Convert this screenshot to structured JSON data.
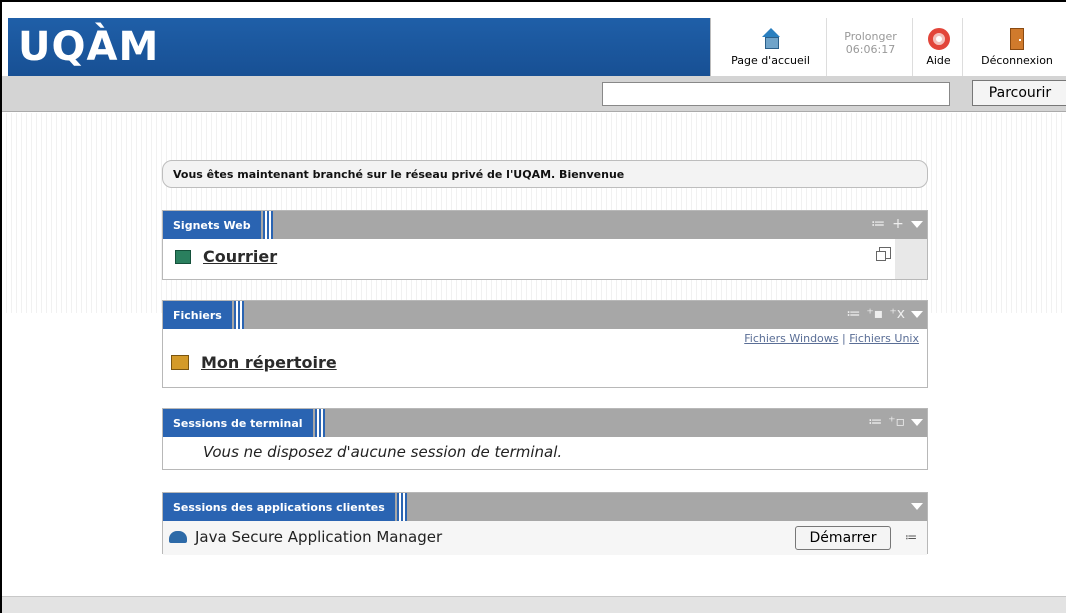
{
  "header": {
    "logo": "UQÀM",
    "home_label": "Page d'accueil",
    "extend_label": "Prolonger",
    "extend_time": "06:06:17",
    "help_label": "Aide",
    "logout_label": "Déconnexion"
  },
  "search": {
    "value": "",
    "button_label": "Parcourir"
  },
  "welcome": "Vous êtes maintenant branché sur le réseau privé de l'UQAM. Bienvenue",
  "bookmarks": {
    "title": "Signets Web",
    "items": [
      {
        "label": "Courrier",
        "icon": "mail-icon"
      }
    ]
  },
  "files": {
    "title": "Fichiers",
    "link_windows": "Fichiers Windows",
    "separator": "|",
    "link_unix": "Fichiers Unix",
    "items": [
      {
        "label": "Mon répertoire",
        "icon": "folder-icon"
      }
    ]
  },
  "terminal": {
    "title": "Sessions de terminal",
    "empty_text": "Vous ne disposez d'aucune session de terminal."
  },
  "client_apps": {
    "title": "Sessions des applications clientes",
    "items": [
      {
        "label": "Java Secure Application Manager",
        "button": "Démarrer"
      }
    ]
  },
  "colors": {
    "brand_blue": "#1f5fa8",
    "panel_tab": "#2a64b2",
    "panel_header": "#a7a7a7"
  }
}
